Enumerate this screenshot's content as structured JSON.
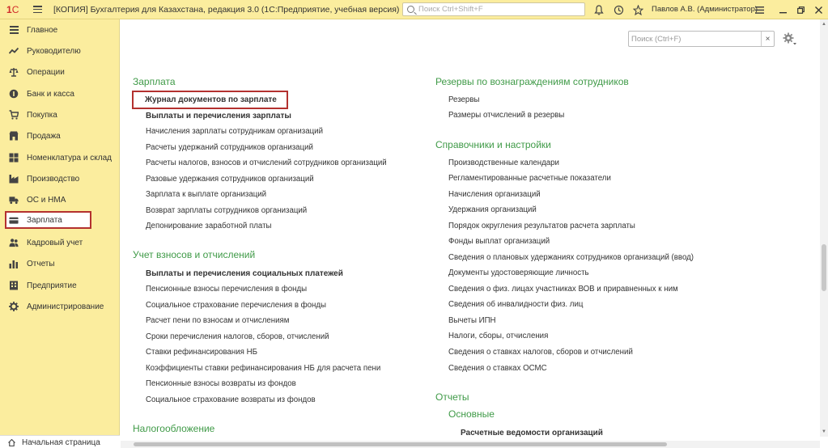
{
  "titlebar": {
    "window_title": "[КОПИЯ] Бухгалтерия для Казахстана, редакция 3.0  (1С:Предприятие, учебная версия)",
    "search_placeholder": "Поиск Ctrl+Shift+F",
    "user": "Павлов А.В. (Администратор)"
  },
  "sidebar": {
    "items": [
      {
        "label": "Главное",
        "icon": "list-icon"
      },
      {
        "label": "Руководителю",
        "icon": "trend-icon"
      },
      {
        "label": "Операции",
        "icon": "scales-icon"
      },
      {
        "label": "Банк и касса",
        "icon": "coins-icon"
      },
      {
        "label": "Покупка",
        "icon": "cart-icon"
      },
      {
        "label": "Продажа",
        "icon": "shop-icon"
      },
      {
        "label": "Номенклатура и склад",
        "icon": "grid-icon"
      },
      {
        "label": "Производство",
        "icon": "factory-icon"
      },
      {
        "label": "ОС и НМА",
        "icon": "truck-icon"
      },
      {
        "label": "Зарплата",
        "icon": "wallet-icon"
      },
      {
        "label": "Кадровый учет",
        "icon": "people-icon"
      },
      {
        "label": "Отчеты",
        "icon": "bar-chart-icon"
      },
      {
        "label": "Предприятие",
        "icon": "building-icon"
      },
      {
        "label": "Администрирование",
        "icon": "gear-icon"
      }
    ],
    "active": "Зарплата",
    "home_label": "Начальная страница"
  },
  "main": {
    "search_placeholder": "Поиск (Ctrl+F)",
    "col1": {
      "salary": {
        "title": "Зарплата",
        "links": [
          "Журнал документов по зарплате",
          "Выплаты и перечисления зарплаты",
          "Начисления зарплаты сотрудникам организаций",
          "Расчеты удержаний сотрудников организаций",
          "Расчеты налогов, взносов и отчислений сотрудников организаций",
          "Разовые удержания сотрудников организаций",
          "Зарплата к выплате организаций",
          "Возврат зарплаты сотрудников организаций",
          "Депонирование заработной платы"
        ]
      },
      "contrib": {
        "title": "Учет взносов и отчислений",
        "links": [
          "Выплаты и перечисления социальных платежей",
          "Пенсионные взносы перечисления в фонды",
          "Социальное страхование перечисления в фонды",
          "Расчет пени по взносам и отчислениям",
          "Сроки перечисления налогов, сборов, отчислений",
          "Ставки рефинансирования НБ",
          "Коэффициенты ставки рефинансирования НБ для расчета пени",
          "Пенсионные взносы возвраты из фондов",
          "Социальное страхование возвраты из фондов"
        ]
      },
      "tax": {
        "title": "Налогообложение"
      }
    },
    "col2": {
      "reserves": {
        "title": "Резервы по вознаграждениям сотрудников",
        "links": [
          "Резервы",
          "Размеры отчислений в резервы"
        ]
      },
      "refs": {
        "title": "Справочники и настройки",
        "links": [
          "Производственные календари",
          "Регламентированные расчетные показатели",
          "Начисления организаций",
          "Удержания организаций",
          "Порядок округления результатов расчета зарплаты",
          "Фонды выплат организаций",
          "Сведения о плановых удержаниях сотрудников организаций (ввод)",
          "Документы удостоверяющие личность",
          "Сведения о физ. лицах участниках ВОВ и приравненных к ним",
          "Сведения об инвалидности физ. лиц",
          "Вычеты ИПН",
          "Налоги, сборы, отчисления",
          "Сведения о ставках налогов, сборов и отчислений",
          "Сведения о ставках ОСМС"
        ]
      },
      "reports": {
        "title": "Отчеты",
        "subtitle": "Основные",
        "links": [
          "Расчетные ведомости организаций"
        ]
      }
    }
  },
  "colors": {
    "sidebar_bg": "#fbed9e",
    "section_green": "#3f9a47",
    "highlight_red": "#b3312f"
  }
}
